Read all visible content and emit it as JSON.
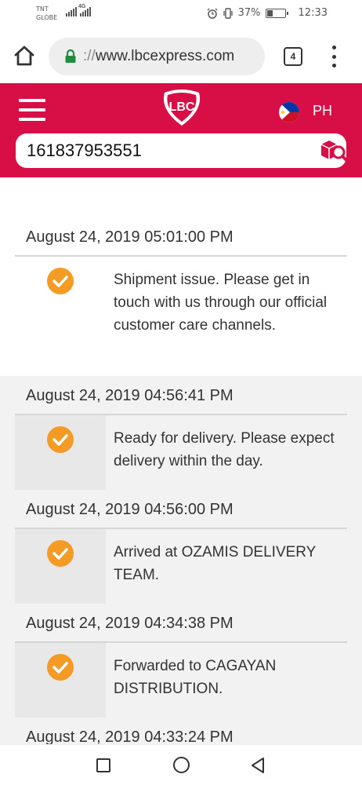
{
  "status_bar": {
    "carrier_line1": "TNT",
    "carrier_line2": "GLOBE",
    "network_label": "4G",
    "battery_percent_text": "37%",
    "battery_level": 0.37,
    "time": "12:33"
  },
  "browser": {
    "url_scheme": "://",
    "url_host": "www.lbcexpress.com",
    "tab_count": "4"
  },
  "header": {
    "logo_text": "LBC",
    "country_code": "PH",
    "brand_color": "#d80f47"
  },
  "search": {
    "tracking_number": "161837953551",
    "icon": "package-search-icon"
  },
  "timeline": [
    {
      "date": "August 24, 2019 05:01:00 PM",
      "description": "Shipment issue. Please get in touch with us through our official customer care channels."
    },
    {
      "date": "August 24, 2019 04:56:41 PM",
      "description": "Ready for delivery. Please expect delivery within the day."
    },
    {
      "date": "August 24, 2019 04:56:00 PM",
      "description": "Arrived at OZAMIS DELIVERY TEAM."
    },
    {
      "date": "August 24, 2019 04:34:38 PM",
      "description": "Forwarded to CAGAYAN DISTRIBUTION."
    },
    {
      "date": "August 24, 2019 04:33:24 PM",
      "description": ""
    }
  ],
  "colors": {
    "check_icon": "#f49b25",
    "row_shade": "#f2f2f2"
  }
}
